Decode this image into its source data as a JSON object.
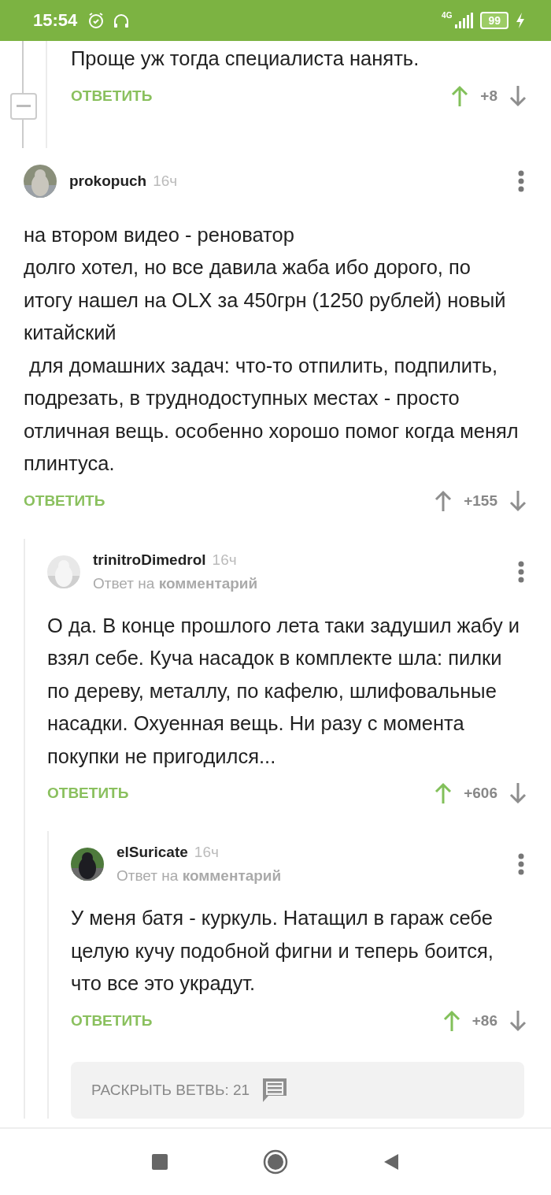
{
  "status_bar": {
    "time": "15:54",
    "network": "4G",
    "battery": "99"
  },
  "previous_comment": {
    "text": "Проще уж тогда специалиста нанять.",
    "reply_label": "ОТВЕТИТЬ",
    "score": "+8",
    "upvoted": true
  },
  "comments": [
    {
      "kind": "comment",
      "author": "prokopuch",
      "time": "16ч",
      "text": "на втором видео - реноватор\nдолго хотел, но все давила жаба ибо дорого, по итогу нашел на OLX за 450грн (1250 рублей) новый китайский\n для домашних задач: что-то отпилить, подпилить, подрезать, в труднодоступных местах - просто отличная вещь. особенно хорошо помог когда менял плинтуса.",
      "reply_label": "ОТВЕТИТЬ",
      "score": "+155",
      "upvoted": false,
      "children": [
        {
          "kind": "comment",
          "author": "trinitroDimedrol",
          "time": "16ч",
          "reply_to": "Ответ на **комментарий**",
          "text": "О да. В конце прошлого лета таки задушил жабу и взял себе. Куча насадок в комплекте шла: пилки по дереву, металлу, по кафелю, шлифовальные насадки. Охуенная вещь. Ни разу с момента покупки не пригодился...",
          "reply_label": "ОТВЕТИТЬ",
          "score": "+606",
          "upvoted": true,
          "children": [
            {
              "kind": "comment",
              "author": "elSuricate",
              "time": "16ч",
              "reply_to": "Ответ на **комментарий**",
              "text": "У меня батя - куркуль. Натащил в гараж себе целую кучу подобной фигни и теперь боится, что все это украдут.",
              "reply_label": "ОТВЕТИТЬ",
              "score": "+86",
              "upvoted": true
            },
            {
              "kind": "expand",
              "label": "РАСКРЫТЬ ВЕТВЬ: 21"
            }
          ]
        }
      ]
    }
  ]
}
